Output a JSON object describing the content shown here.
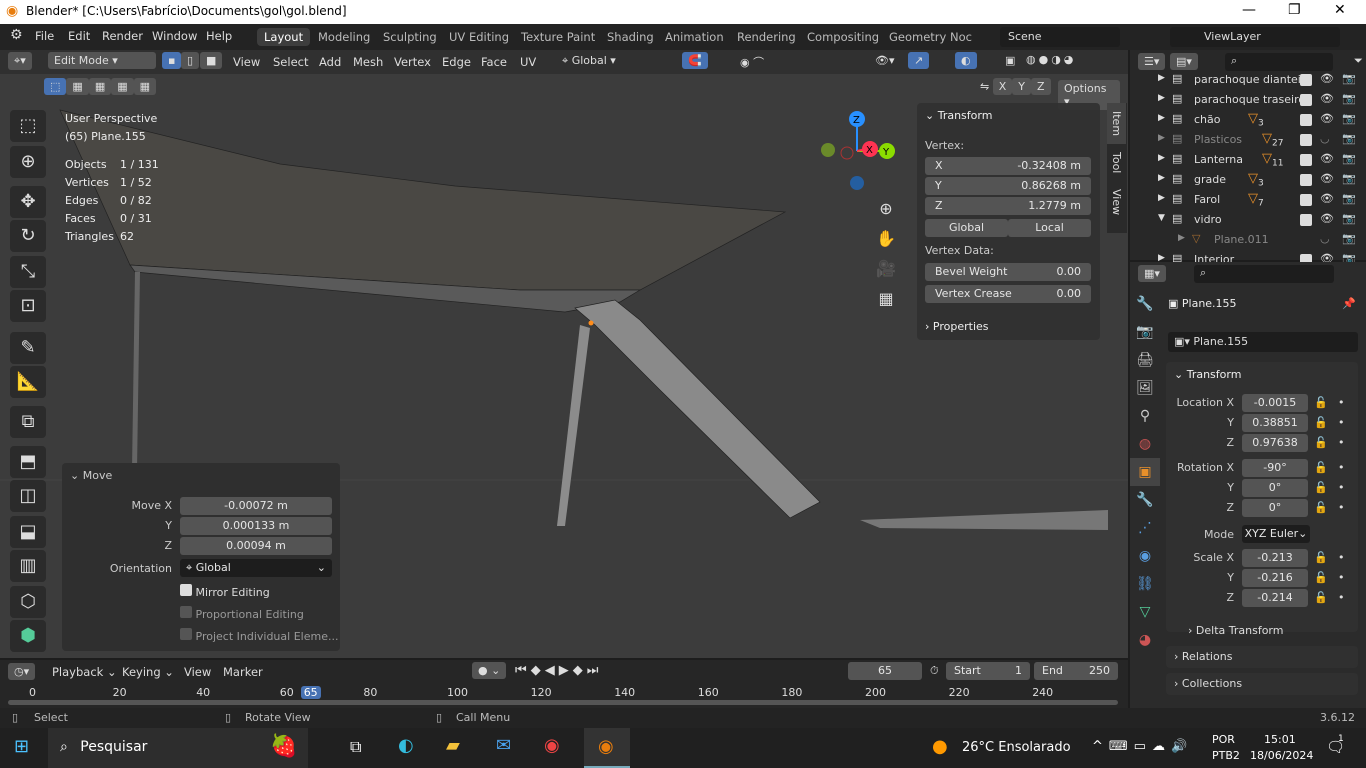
{
  "window": {
    "title": "Blender* [C:\\Users\\Fabrício\\Documents\\gol\\gol.blend]"
  },
  "menu": [
    "File",
    "Edit",
    "Render",
    "Window",
    "Help"
  ],
  "workspaces": [
    "Layout",
    "Modeling",
    "Sculpting",
    "UV Editing",
    "Texture Paint",
    "Shading",
    "Animation",
    "Rendering",
    "Compositing",
    "Geometry Noc"
  ],
  "scene": "Scene",
  "view_layer": "ViewLayer",
  "viewport_header": {
    "mode": "Edit Mode",
    "menus": [
      "View",
      "Select",
      "Add",
      "Mesh",
      "Vertex",
      "Edge",
      "Face",
      "UV"
    ],
    "orientation": "Global",
    "axes": [
      "X",
      "Y",
      "Z"
    ],
    "options": "Options"
  },
  "overlay_info": {
    "view": "User Perspective",
    "object": "(65) Plane.155",
    "stats": [
      [
        "Objects",
        "1 / 131"
      ],
      [
        "Vertices",
        "1 / 52"
      ],
      [
        "Edges",
        "0 / 82"
      ],
      [
        "Faces",
        "0 / 31"
      ],
      [
        "Triangles",
        "62"
      ]
    ]
  },
  "gizmo": {
    "x": "X",
    "y": "Y",
    "z": "Z"
  },
  "npanel": {
    "tabs": [
      "Item",
      "Tool",
      "View"
    ],
    "transform": "Transform",
    "vertex": "Vertex:",
    "coords": [
      [
        "X",
        "-0.32408 m"
      ],
      [
        "Y",
        "0.86268 m"
      ],
      [
        "Z",
        "1.2779 m"
      ]
    ],
    "global": "Global",
    "local": "Local",
    "vertex_data": "Vertex Data:",
    "bevel": [
      "Bevel Weight",
      "0.00"
    ],
    "crease": [
      "Vertex Crease",
      "0.00"
    ],
    "properties": "Properties"
  },
  "move_panel": {
    "title": "Move",
    "rows": [
      [
        "Move X",
        "-0.00072 m"
      ],
      [
        "Y",
        "0.000133 m"
      ],
      [
        "Z",
        "0.00094 m"
      ]
    ],
    "orientation_label": "Orientation",
    "orientation": "Global",
    "checks": [
      {
        "label": "Mirror Editing",
        "on": true
      },
      {
        "label": "Proportional Editing",
        "on": false
      },
      {
        "label": "Project Individual Eleme...",
        "on": false
      }
    ]
  },
  "outliner": [
    {
      "name": "parachoque diantein",
      "count": "",
      "dim": false
    },
    {
      "name": "parachoque traseiro",
      "count": "",
      "dim": false
    },
    {
      "name": "chão",
      "count": "3",
      "dim": false
    },
    {
      "name": "Plasticos",
      "count": "27",
      "dim": true
    },
    {
      "name": "Lanterna",
      "count": "11",
      "dim": false
    },
    {
      "name": "grade",
      "count": "3",
      "dim": false
    },
    {
      "name": "Farol",
      "count": "7",
      "dim": false
    },
    {
      "name": "vidro",
      "count": "",
      "dim": false
    },
    {
      "name": "Plane.011",
      "count": "",
      "dim": true
    },
    {
      "name": "Interior",
      "count": "",
      "dim": false
    }
  ],
  "properties": {
    "object": "Plane.155",
    "data_name": "Plane.155",
    "transform": "Transform",
    "location": [
      [
        "Location X",
        "-0.0015"
      ],
      [
        "Y",
        "0.38851"
      ],
      [
        "Z",
        "0.97638"
      ]
    ],
    "rotation": [
      [
        "Rotation X",
        "-90°"
      ],
      [
        "Y",
        "0°"
      ],
      [
        "Z",
        "0°"
      ]
    ],
    "mode_label": "Mode",
    "mode": "XYZ Euler",
    "scale": [
      [
        "Scale X",
        "-0.213"
      ],
      [
        "Y",
        "-0.216"
      ],
      [
        "Z",
        "-0.214"
      ]
    ],
    "sections": [
      "Delta Transform",
      "Relations",
      "Collections"
    ]
  },
  "timeline": {
    "menus": [
      "Playback",
      "Keying",
      "View",
      "Marker"
    ],
    "current": "65",
    "start_label": "Start",
    "start": "1",
    "end_label": "End",
    "end": "250",
    "ticks": [
      "0",
      "20",
      "40",
      "60",
      "65",
      "80",
      "100",
      "120",
      "140",
      "160",
      "180",
      "200",
      "220",
      "240"
    ]
  },
  "status": {
    "select": "Select",
    "rotate": "Rotate View",
    "call_menu": "Call Menu",
    "version": "3.6.12"
  },
  "taskbar": {
    "search": "Pesquisar",
    "weather": "26°C Ensolarado",
    "lang1": "POR",
    "lang2": "PTB2",
    "time": "15:01",
    "date": "18/06/2024",
    "notif": "1"
  },
  "colors": {
    "accent": "#4772b3",
    "vertex_selected": "#ff8c1a",
    "x_axis": "#ff3352",
    "y_axis": "#8bdc00",
    "z_axis": "#2890ff"
  }
}
